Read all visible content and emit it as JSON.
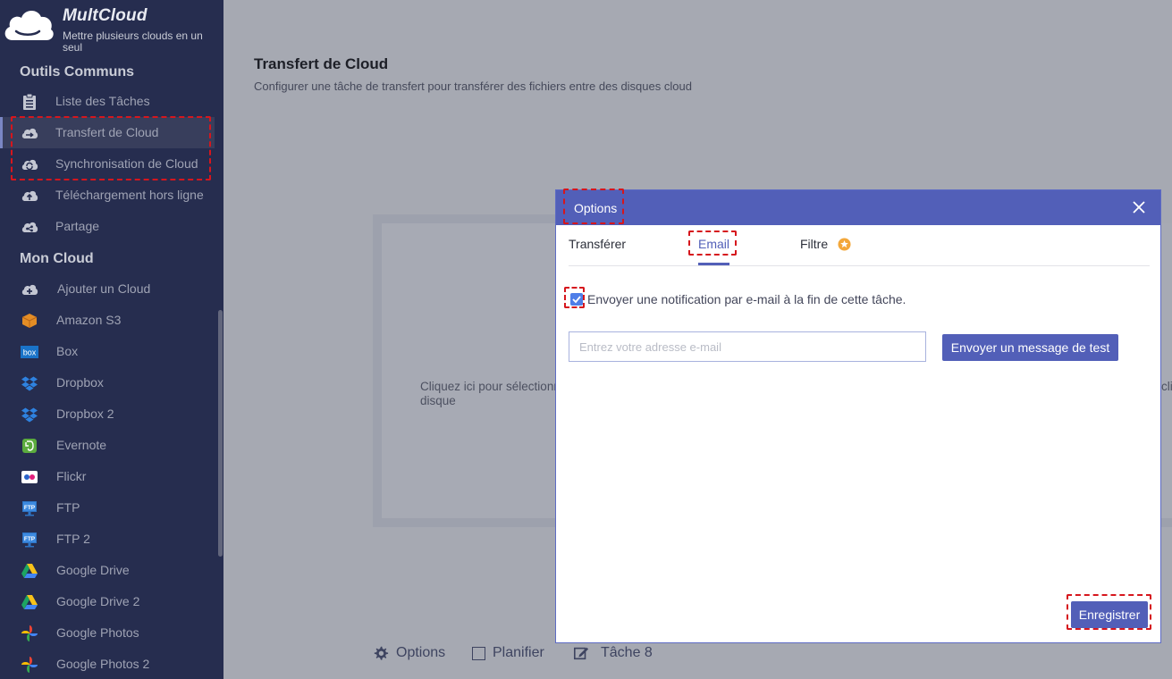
{
  "brand": {
    "name": "MultCloud",
    "tagline": "Mettre plusieurs clouds en un seul"
  },
  "sidebar": {
    "section_tools": "Outils Communs",
    "tools": [
      {
        "label": "Liste des Tâches",
        "icon": "clipboard-icon"
      },
      {
        "label": "Transfert de Cloud",
        "icon": "cloud-transfer-icon",
        "active": true
      },
      {
        "label": "Synchronisation de Cloud",
        "icon": "cloud-sync-icon"
      },
      {
        "label": "Téléchargement hors ligne",
        "icon": "cloud-upload-icon"
      },
      {
        "label": "Partage",
        "icon": "cloud-share-icon"
      }
    ],
    "section_clouds": "Mon Cloud",
    "clouds": [
      {
        "label": "Ajouter un Cloud",
        "icon": "cloud-add-icon"
      },
      {
        "label": "Amazon S3",
        "icon": "amazon-s3-icon"
      },
      {
        "label": "Box",
        "icon": "box-icon",
        "icon_text": "box"
      },
      {
        "label": "Dropbox",
        "icon": "dropbox-icon"
      },
      {
        "label": "Dropbox 2",
        "icon": "dropbox-icon"
      },
      {
        "label": "Evernote",
        "icon": "evernote-icon"
      },
      {
        "label": "Flickr",
        "icon": "flickr-icon"
      },
      {
        "label": "FTP",
        "icon": "ftp-icon",
        "icon_text": "FTP"
      },
      {
        "label": "FTP 2",
        "icon": "ftp-icon",
        "icon_text": "FTP"
      },
      {
        "label": "Google Drive",
        "icon": "google-drive-icon"
      },
      {
        "label": "Google Drive 2",
        "icon": "google-drive-icon"
      },
      {
        "label": "Google Photos",
        "icon": "google-photos-icon"
      },
      {
        "label": "Google Photos 2",
        "icon": "google-photos-icon"
      }
    ]
  },
  "main": {
    "title": "Transfert de Cloud",
    "subtitle": "Configurer une tâche de transfert pour transférer des fichiers entre des disques cloud",
    "source_prompt": "Cliquez ici pour sélectionner\ndisque",
    "target_prompt_fragment": "clic"
  },
  "bottom_bar": {
    "options_label": "Options",
    "schedule_label": "Planifier",
    "task_label": "Tâche 8"
  },
  "modal": {
    "title": "Options",
    "tabs": [
      {
        "label": "Transférer"
      },
      {
        "label": "Email",
        "active": true
      },
      {
        "label": "Filtre",
        "badge": "premium-star-icon"
      }
    ],
    "notify_label": "Envoyer une notification par e-mail à la fin de cette tâche.",
    "notify_checked": true,
    "email_placeholder": "Entrez votre adresse e-mail",
    "email_value": "",
    "test_button": "Envoyer un message de test",
    "save_button": "Enregistrer"
  },
  "colors": {
    "sidebar_bg": "#262d4f",
    "accent": "#525fb8",
    "highlight": "#d6161d",
    "overlay_bg": "#a6a9b2"
  }
}
